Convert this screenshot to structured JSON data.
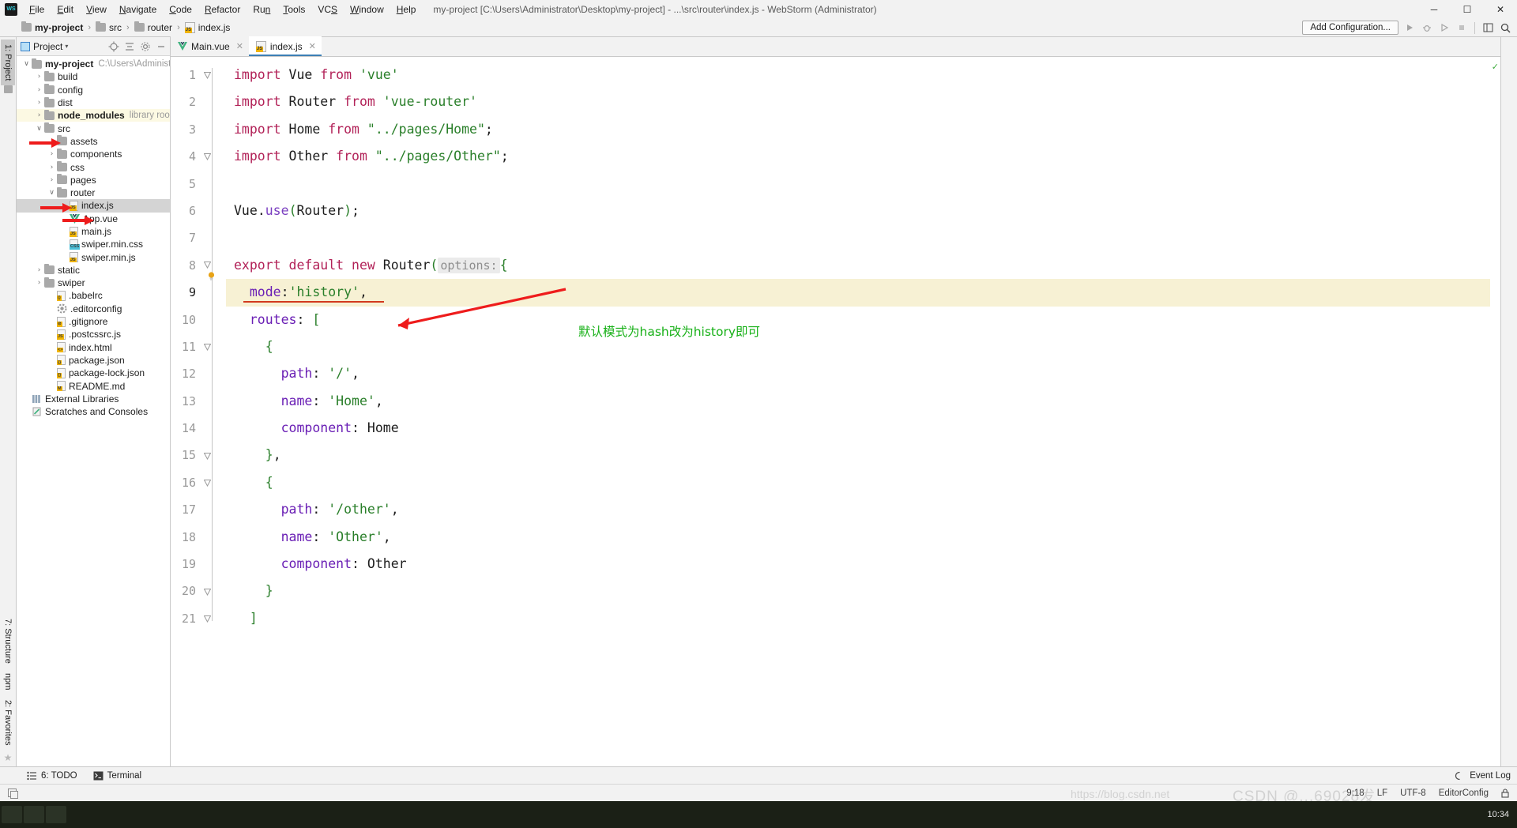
{
  "window": {
    "logo_text": "WS",
    "title": "my-project [C:\\Users\\Administrator\\Desktop\\my-project] - ...\\src\\router\\index.js - WebStorm (Administrator)",
    "minimize": "─",
    "maximize": "☐",
    "close": "✕"
  },
  "menu": [
    {
      "label": "File",
      "mnemonic": "F"
    },
    {
      "label": "Edit",
      "mnemonic": "E"
    },
    {
      "label": "View",
      "mnemonic": "V"
    },
    {
      "label": "Navigate",
      "mnemonic": "N"
    },
    {
      "label": "Code",
      "mnemonic": "C"
    },
    {
      "label": "Refactor",
      "mnemonic": "R"
    },
    {
      "label": "Run",
      "mnemonic": "n"
    },
    {
      "label": "Tools",
      "mnemonic": "T"
    },
    {
      "label": "VCS",
      "mnemonic": "S"
    },
    {
      "label": "Window",
      "mnemonic": "W"
    },
    {
      "label": "Help",
      "mnemonic": "H"
    }
  ],
  "navbar": {
    "breadcrumbs": [
      {
        "label": "my-project",
        "icon": "folder-icon",
        "bold": true
      },
      {
        "label": "src",
        "icon": "folder-icon",
        "bold": false
      },
      {
        "label": "router",
        "icon": "folder-icon",
        "bold": false
      },
      {
        "label": "index.js",
        "icon": "js-file-icon",
        "bold": false
      }
    ],
    "separator": "›",
    "add_configuration": "Add Configuration...",
    "icons": [
      "run-icon",
      "debug-icon",
      "coverage-icon",
      "stop-icon",
      "layout-icon",
      "search-icon"
    ]
  },
  "left_strip": {
    "project_tab": "1: Project",
    "structure_tab": "7: Structure",
    "npm_tab": "npm",
    "favorites_tab": "2: Favorites"
  },
  "project_panel": {
    "header_label": "Project",
    "header_caret": "▾",
    "header_icons": [
      "locate-icon",
      "collapse-all-icon",
      "settings-icon",
      "hide-icon"
    ],
    "tree": [
      {
        "indent": 0,
        "arrow": "∨",
        "icon": "folder-icon",
        "label": "my-project",
        "bold": true,
        "gray": "C:\\Users\\Administrato",
        "state": "normal"
      },
      {
        "indent": 1,
        "arrow": "›",
        "icon": "folder-icon",
        "label": "build",
        "bold": false,
        "gray": "",
        "state": "normal"
      },
      {
        "indent": 1,
        "arrow": "›",
        "icon": "folder-icon",
        "label": "config",
        "bold": false,
        "gray": "",
        "state": "normal"
      },
      {
        "indent": 1,
        "arrow": "›",
        "icon": "folder-icon",
        "label": "dist",
        "bold": false,
        "gray": "",
        "state": "normal"
      },
      {
        "indent": 1,
        "arrow": "›",
        "icon": "folder-icon",
        "label": "node_modules",
        "bold": true,
        "gray": "library root",
        "state": "yellow"
      },
      {
        "indent": 1,
        "arrow": "∨",
        "icon": "folder-icon",
        "label": "src",
        "bold": false,
        "gray": "",
        "state": "normal"
      },
      {
        "indent": 2,
        "arrow": "›",
        "icon": "folder-icon",
        "label": "assets",
        "bold": false,
        "gray": "",
        "state": "normal"
      },
      {
        "indent": 2,
        "arrow": "›",
        "icon": "folder-icon",
        "label": "components",
        "bold": false,
        "gray": "",
        "state": "normal"
      },
      {
        "indent": 2,
        "arrow": "›",
        "icon": "folder-icon",
        "label": "css",
        "bold": false,
        "gray": "",
        "state": "normal"
      },
      {
        "indent": 2,
        "arrow": "›",
        "icon": "folder-icon",
        "label": "pages",
        "bold": false,
        "gray": "",
        "state": "normal"
      },
      {
        "indent": 2,
        "arrow": "∨",
        "icon": "folder-icon",
        "label": "router",
        "bold": false,
        "gray": "",
        "state": "normal"
      },
      {
        "indent": 3,
        "arrow": "",
        "icon": "js-file-icon",
        "label": "index.js",
        "bold": false,
        "gray": "",
        "state": "selected"
      },
      {
        "indent": 3,
        "arrow": "",
        "icon": "vue-file-icon",
        "label": "App.vue",
        "bold": false,
        "gray": "",
        "state": "normal"
      },
      {
        "indent": 3,
        "arrow": "",
        "icon": "js-file-icon",
        "label": "main.js",
        "bold": false,
        "gray": "",
        "state": "normal"
      },
      {
        "indent": 3,
        "arrow": "",
        "icon": "css-file-icon",
        "label": "swiper.min.css",
        "bold": false,
        "gray": "",
        "state": "normal"
      },
      {
        "indent": 3,
        "arrow": "",
        "icon": "min-js-file-icon",
        "label": "swiper.min.js",
        "bold": false,
        "gray": "",
        "state": "normal"
      },
      {
        "indent": 1,
        "arrow": "›",
        "icon": "folder-icon",
        "label": "static",
        "bold": false,
        "gray": "",
        "state": "normal"
      },
      {
        "indent": 1,
        "arrow": "›",
        "icon": "folder-icon",
        "label": "swiper",
        "bold": false,
        "gray": "",
        "state": "normal"
      },
      {
        "indent": 2,
        "arrow": "",
        "icon": "babelrc-file-icon",
        "label": ".babelrc",
        "bold": false,
        "gray": "",
        "state": "normal"
      },
      {
        "indent": 2,
        "arrow": "",
        "icon": "gear-file-icon",
        "label": ".editorconfig",
        "bold": false,
        "gray": "",
        "state": "normal"
      },
      {
        "indent": 2,
        "arrow": "",
        "icon": "gitignore-file-icon",
        "label": ".gitignore",
        "bold": false,
        "gray": "",
        "state": "normal"
      },
      {
        "indent": 2,
        "arrow": "",
        "icon": "js-file-icon",
        "label": ".postcssrc.js",
        "bold": false,
        "gray": "",
        "state": "normal"
      },
      {
        "indent": 2,
        "arrow": "",
        "icon": "html-file-icon",
        "label": "index.html",
        "bold": false,
        "gray": "",
        "state": "normal"
      },
      {
        "indent": 2,
        "arrow": "",
        "icon": "json-file-icon",
        "label": "package.json",
        "bold": false,
        "gray": "",
        "state": "normal"
      },
      {
        "indent": 2,
        "arrow": "",
        "icon": "json-file-icon",
        "label": "package-lock.json",
        "bold": false,
        "gray": "",
        "state": "normal"
      },
      {
        "indent": 2,
        "arrow": "",
        "icon": "md-file-icon",
        "label": "README.md",
        "bold": false,
        "gray": "",
        "state": "normal"
      },
      {
        "indent": 0,
        "arrow": "",
        "icon": "library-icon",
        "label": "External Libraries",
        "bold": false,
        "gray": "",
        "state": "normal"
      },
      {
        "indent": 0,
        "arrow": "",
        "icon": "scratches-icon",
        "label": "Scratches and Consoles",
        "bold": false,
        "gray": "",
        "state": "normal"
      }
    ]
  },
  "editor": {
    "tabs": [
      {
        "label": "Main.vue",
        "icon": "vue-file-icon",
        "active": false,
        "close": "✕"
      },
      {
        "label": "index.js",
        "icon": "js-file-icon",
        "active": true,
        "close": "✕"
      }
    ],
    "line_numbers": [
      "1",
      "2",
      "3",
      "4",
      "5",
      "6",
      "7",
      "8",
      "9",
      "10",
      "11",
      "12",
      "13",
      "14",
      "15",
      "16",
      "17",
      "18",
      "19",
      "20",
      "21"
    ],
    "current_line": 9,
    "inlay_hint": "options:",
    "code_lines": [
      {
        "n": 1,
        "tokens": [
          {
            "t": "import",
            "c": "kw"
          },
          {
            "t": " Vue ",
            "c": "ident"
          },
          {
            "t": "from",
            "c": "kw"
          },
          {
            "t": " ",
            "c": "ident"
          },
          {
            "t": "'vue'",
            "c": "str"
          }
        ]
      },
      {
        "n": 2,
        "tokens": [
          {
            "t": "import",
            "c": "kw"
          },
          {
            "t": " Router ",
            "c": "ident"
          },
          {
            "t": "from",
            "c": "kw"
          },
          {
            "t": " ",
            "c": "ident"
          },
          {
            "t": "'vue-router'",
            "c": "str"
          }
        ]
      },
      {
        "n": 3,
        "tokens": [
          {
            "t": "import",
            "c": "kw"
          },
          {
            "t": " Home ",
            "c": "ident"
          },
          {
            "t": "from",
            "c": "kw"
          },
          {
            "t": " ",
            "c": "ident"
          },
          {
            "t": "\"../pages/Home\"",
            "c": "str"
          },
          {
            "t": ";",
            "c": "punc"
          }
        ]
      },
      {
        "n": 4,
        "tokens": [
          {
            "t": "import",
            "c": "kw"
          },
          {
            "t": " Other ",
            "c": "ident"
          },
          {
            "t": "from",
            "c": "kw"
          },
          {
            "t": " ",
            "c": "ident"
          },
          {
            "t": "\"../pages/Other\"",
            "c": "str"
          },
          {
            "t": ";",
            "c": "punc"
          }
        ]
      },
      {
        "n": 5,
        "tokens": []
      },
      {
        "n": 6,
        "tokens": [
          {
            "t": "Vue",
            "c": "ident"
          },
          {
            "t": ".",
            "c": "punc"
          },
          {
            "t": "use",
            "c": "fn"
          },
          {
            "t": "(",
            "c": "paren"
          },
          {
            "t": "Router",
            "c": "ident"
          },
          {
            "t": ")",
            "c": "paren"
          },
          {
            "t": ";",
            "c": "punc"
          }
        ]
      },
      {
        "n": 7,
        "tokens": []
      },
      {
        "n": 8,
        "tokens": [
          {
            "t": "export",
            "c": "kw"
          },
          {
            "t": " ",
            "c": "ident"
          },
          {
            "t": "default",
            "c": "kw"
          },
          {
            "t": " ",
            "c": "ident"
          },
          {
            "t": "new",
            "c": "kw"
          },
          {
            "t": " Router",
            "c": "ident"
          },
          {
            "t": "(",
            "c": "paren"
          },
          {
            "t": "options:",
            "c": "hint"
          },
          {
            "t": "{",
            "c": "paren"
          }
        ]
      },
      {
        "n": 9,
        "tokens": [
          {
            "t": "  ",
            "c": "ident"
          },
          {
            "t": "mode",
            "c": "prop"
          },
          {
            "t": ":",
            "c": "punc"
          },
          {
            "t": "'history'",
            "c": "str"
          },
          {
            "t": ",",
            "c": "punc"
          }
        ]
      },
      {
        "n": 10,
        "tokens": [
          {
            "t": "  ",
            "c": "ident"
          },
          {
            "t": "routes",
            "c": "prop"
          },
          {
            "t": ": ",
            "c": "punc"
          },
          {
            "t": "[",
            "c": "paren"
          }
        ]
      },
      {
        "n": 11,
        "tokens": [
          {
            "t": "    ",
            "c": "ident"
          },
          {
            "t": "{",
            "c": "paren"
          }
        ]
      },
      {
        "n": 12,
        "tokens": [
          {
            "t": "      ",
            "c": "ident"
          },
          {
            "t": "path",
            "c": "prop"
          },
          {
            "t": ": ",
            "c": "punc"
          },
          {
            "t": "'/'",
            "c": "str"
          },
          {
            "t": ",",
            "c": "punc"
          }
        ]
      },
      {
        "n": 13,
        "tokens": [
          {
            "t": "      ",
            "c": "ident"
          },
          {
            "t": "name",
            "c": "prop"
          },
          {
            "t": ": ",
            "c": "punc"
          },
          {
            "t": "'Home'",
            "c": "str"
          },
          {
            "t": ",",
            "c": "punc"
          }
        ]
      },
      {
        "n": 14,
        "tokens": [
          {
            "t": "      ",
            "c": "ident"
          },
          {
            "t": "component",
            "c": "prop"
          },
          {
            "t": ": ",
            "c": "punc"
          },
          {
            "t": "Home",
            "c": "ident"
          }
        ]
      },
      {
        "n": 15,
        "tokens": [
          {
            "t": "    ",
            "c": "ident"
          },
          {
            "t": "}",
            "c": "paren"
          },
          {
            "t": ",",
            "c": "punc"
          }
        ]
      },
      {
        "n": 16,
        "tokens": [
          {
            "t": "    ",
            "c": "ident"
          },
          {
            "t": "{",
            "c": "paren"
          }
        ]
      },
      {
        "n": 17,
        "tokens": [
          {
            "t": "      ",
            "c": "ident"
          },
          {
            "t": "path",
            "c": "prop"
          },
          {
            "t": ": ",
            "c": "punc"
          },
          {
            "t": "'/other'",
            "c": "str"
          },
          {
            "t": ",",
            "c": "punc"
          }
        ]
      },
      {
        "n": 18,
        "tokens": [
          {
            "t": "      ",
            "c": "ident"
          },
          {
            "t": "name",
            "c": "prop"
          },
          {
            "t": ": ",
            "c": "punc"
          },
          {
            "t": "'Other'",
            "c": "str"
          },
          {
            "t": ",",
            "c": "punc"
          }
        ]
      },
      {
        "n": 19,
        "tokens": [
          {
            "t": "      ",
            "c": "ident"
          },
          {
            "t": "component",
            "c": "prop"
          },
          {
            "t": ": ",
            "c": "punc"
          },
          {
            "t": "Other",
            "c": "ident"
          }
        ]
      },
      {
        "n": 20,
        "tokens": [
          {
            "t": "    ",
            "c": "ident"
          },
          {
            "t": "}",
            "c": "paren"
          }
        ]
      },
      {
        "n": 21,
        "tokens": [
          {
            "t": "  ",
            "c": "ident"
          },
          {
            "t": "]",
            "c": "paren"
          }
        ]
      }
    ]
  },
  "annotation": {
    "text": "默认模式为hash改为history即可",
    "color": "#16b016",
    "arrow_color": "#ee1c1c"
  },
  "bottom_toolbar": {
    "todo_label": "6: TODO",
    "todo_mnemonic": "6",
    "terminal_label": "Terminal",
    "event_log_label": "Event Log"
  },
  "status_bar": {
    "caret_position": "9:18",
    "line_separator": "LF",
    "encoding": "UTF-8",
    "editorconfig": "EditorConfig",
    "lock_icon": "lock-icon"
  },
  "watermark": {
    "text_left": "https://blog.csdn.net",
    "text_big": "CSDN @...69028发"
  },
  "taskbar": {
    "clock_time": "10:34"
  },
  "colors": {
    "accent": "#3d7fb5",
    "keyword": "#b22258",
    "string": "#2a7f2a",
    "property": "#6a1fb5",
    "highlight_line": "#f7f1d4",
    "selection": "#d4d4d4",
    "yellow_row": "#fcf9e3",
    "annotation": "#16b016",
    "red_arrow": "#ee1c1c"
  }
}
